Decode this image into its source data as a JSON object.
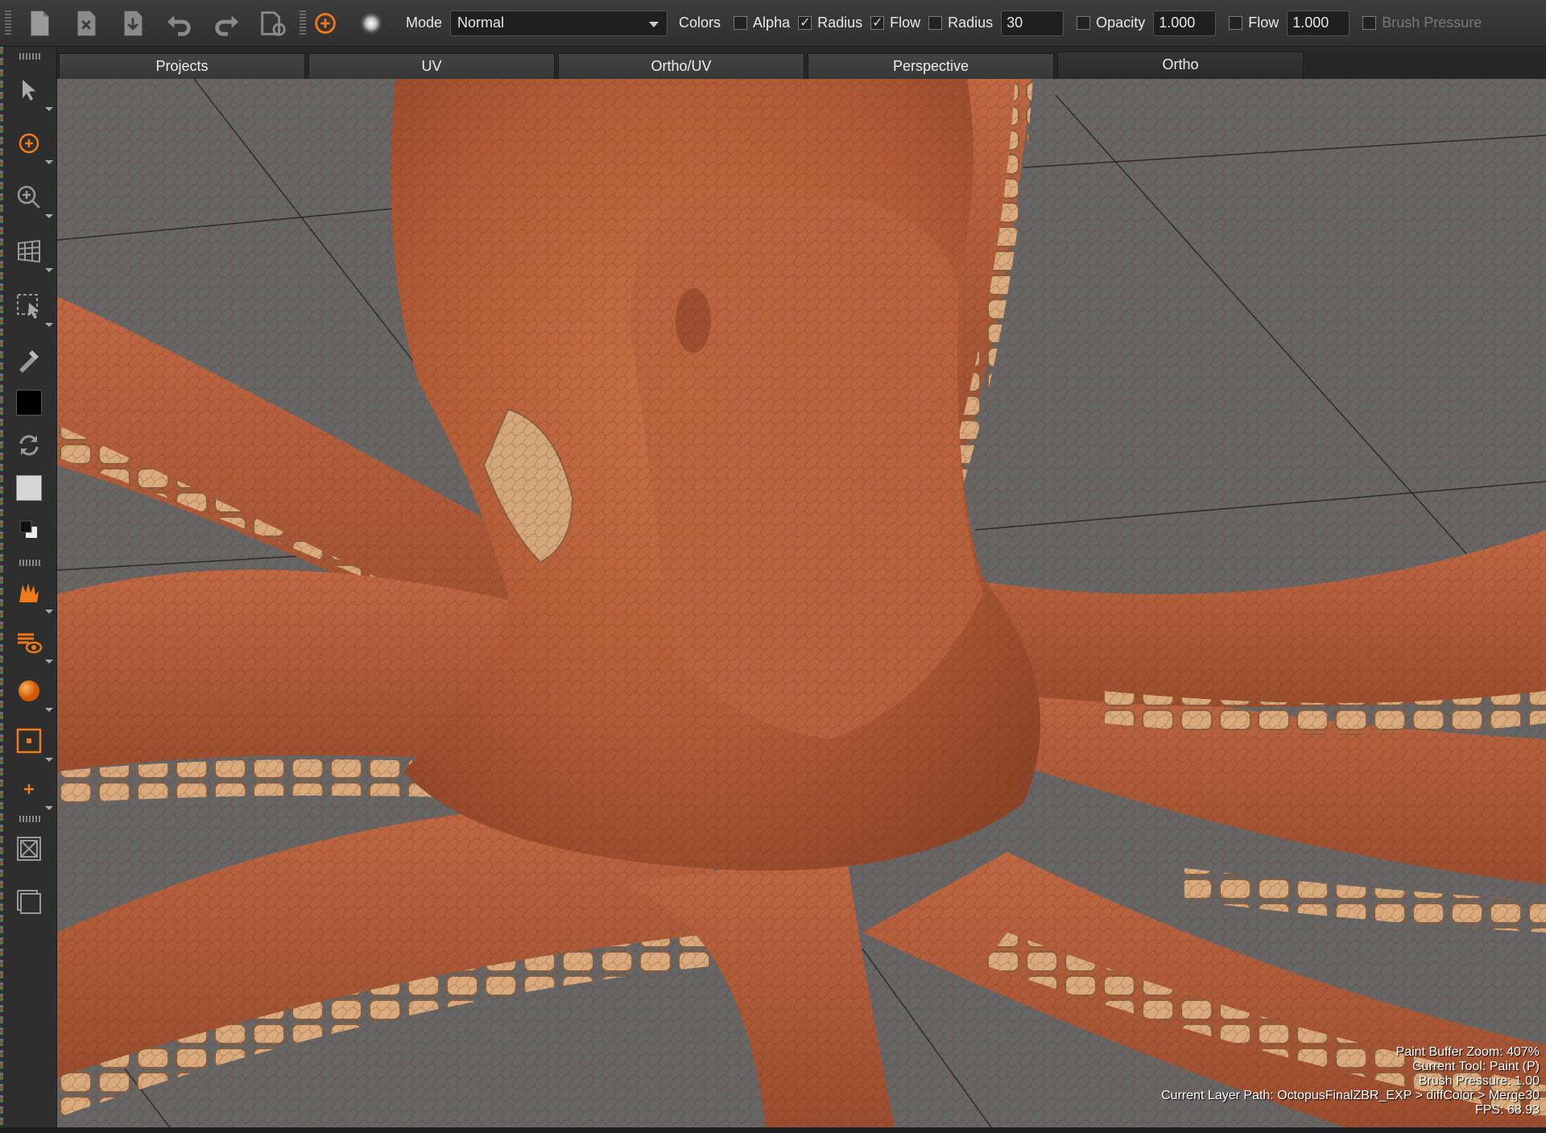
{
  "toolbar": {
    "mode_label": "Mode",
    "mode_value": "Normal",
    "colors_label": "Colors",
    "alpha_label": "Alpha",
    "alpha_checked": false,
    "radius_label": "Radius",
    "radius_checked": true,
    "flow_label": "Flow",
    "flow_checked": true,
    "radius_field_label": "Radius",
    "radius_checkbox_checked": false,
    "radius_value": "30",
    "opacity_label": "Opacity",
    "opacity_checked": false,
    "opacity_value": "1.000",
    "flow_field_label": "Flow",
    "flow_field_checked": false,
    "flow_value": "1.000",
    "brush_pressure_label": "Brush Pressure",
    "brush_pressure_checked": false,
    "icons": [
      "new-file-icon",
      "close-file-icon",
      "save-file-icon",
      "undo-icon",
      "redo-icon",
      "settings-icon",
      "paint-tool-icon",
      "brush-preview-icon"
    ],
    "accent_color": "#f07a1a"
  },
  "tabs": [
    {
      "label": "Projects",
      "active": false
    },
    {
      "label": "UV",
      "active": false
    },
    {
      "label": "Ortho/UV",
      "active": false
    },
    {
      "label": "Perspective",
      "active": false
    },
    {
      "label": "Ortho",
      "active": true
    }
  ],
  "sidebar": {
    "tools": [
      "select-arrow-icon",
      "paint-tool-icon",
      "zoom-icon",
      "grid-icon",
      "marquee-select-icon",
      "eyedropper-icon",
      "foreground-color-swatch",
      "swap-colors-icon",
      "background-color-swatch",
      "default-colors-icon",
      "stamp-tool-icon",
      "layer-visibility-icon",
      "sphere-icon",
      "crop-frame-icon",
      "plus-icon",
      "close-frame-icon",
      "resize-frame-icon"
    ],
    "foreground_color": "#000000",
    "background_color": "#d6d6d6"
  },
  "viewport": {
    "subject": "octopus",
    "background_color": "#666666",
    "skin_color": "#b5603a"
  },
  "hud": {
    "paint_buffer_zoom": "Paint Buffer Zoom: 407%",
    "current_tool": "Current Tool: Paint (P)",
    "brush_pressure": "Brush Pressure: 1.00",
    "layer_path": "Current Layer Path: OctopusFinalZBR_EXP > diffColor > Merge30",
    "fps": "FPS: 68.93"
  }
}
